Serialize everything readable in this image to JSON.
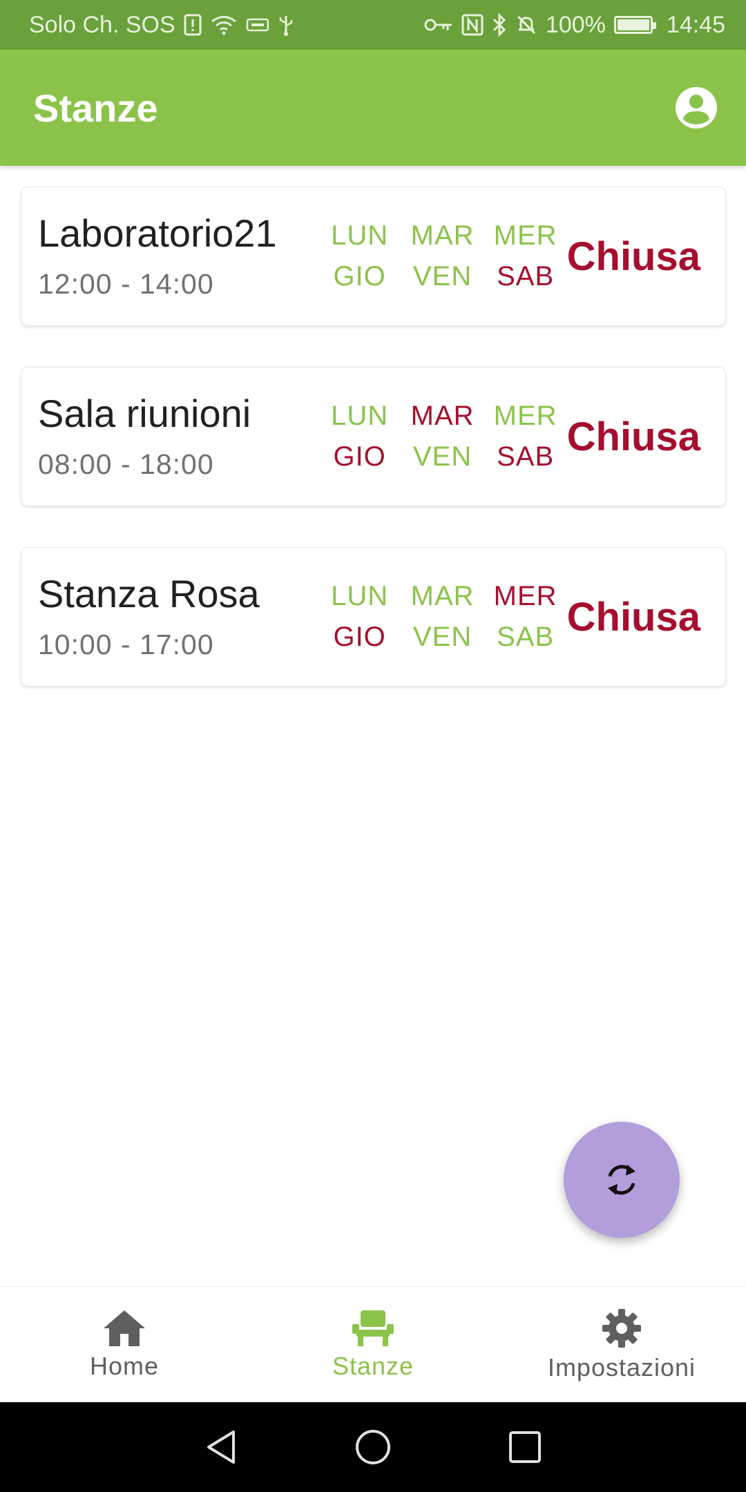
{
  "status_bar": {
    "carrier": "Solo Ch. SOS",
    "battery": "100%",
    "time": "14:45",
    "icons": [
      "sim-alert-icon",
      "wifi-icon",
      "vpn-icon",
      "usb-icon",
      "key-icon",
      "nfc-icon",
      "bluetooth-icon",
      "bell-off-icon",
      "battery-icon"
    ]
  },
  "app_bar": {
    "title": "Stanze",
    "account_icon": "account-circle-icon"
  },
  "colors": {
    "primary": "#8bc34a",
    "status_bar": "#6aa13b",
    "open": "#8bc34a",
    "closed": "#a50f2d",
    "fab": "#b39ddb"
  },
  "rooms": [
    {
      "name": "Laboratorio21",
      "hours": "12:00 - 14:00",
      "status": "Chiusa",
      "days": [
        {
          "label": "LUN",
          "open": true
        },
        {
          "label": "MAR",
          "open": true
        },
        {
          "label": "MER",
          "open": true
        },
        {
          "label": "GIO",
          "open": true
        },
        {
          "label": "VEN",
          "open": true
        },
        {
          "label": "SAB",
          "open": false
        }
      ]
    },
    {
      "name": "Sala riunioni",
      "hours": "08:00 - 18:00",
      "status": "Chiusa",
      "days": [
        {
          "label": "LUN",
          "open": true
        },
        {
          "label": "MAR",
          "open": false
        },
        {
          "label": "MER",
          "open": true
        },
        {
          "label": "GIO",
          "open": false
        },
        {
          "label": "VEN",
          "open": true
        },
        {
          "label": "SAB",
          "open": false
        }
      ]
    },
    {
      "name": "Stanza Rosa",
      "hours": "10:00 - 17:00",
      "status": "Chiusa",
      "days": [
        {
          "label": "LUN",
          "open": true
        },
        {
          "label": "MAR",
          "open": true
        },
        {
          "label": "MER",
          "open": false
        },
        {
          "label": "GIO",
          "open": false
        },
        {
          "label": "VEN",
          "open": true
        },
        {
          "label": "SAB",
          "open": true
        }
      ]
    }
  ],
  "fab": {
    "icon": "refresh-icon"
  },
  "bottom_nav": {
    "items": [
      {
        "label": "Home",
        "icon": "home-icon",
        "active": false
      },
      {
        "label": "Stanze",
        "icon": "seat-icon",
        "active": true
      },
      {
        "label": "Impostazioni",
        "icon": "gear-icon",
        "active": false
      }
    ]
  },
  "system_nav": {
    "icons": [
      "back-icon",
      "home-circle-icon",
      "recents-icon"
    ]
  }
}
